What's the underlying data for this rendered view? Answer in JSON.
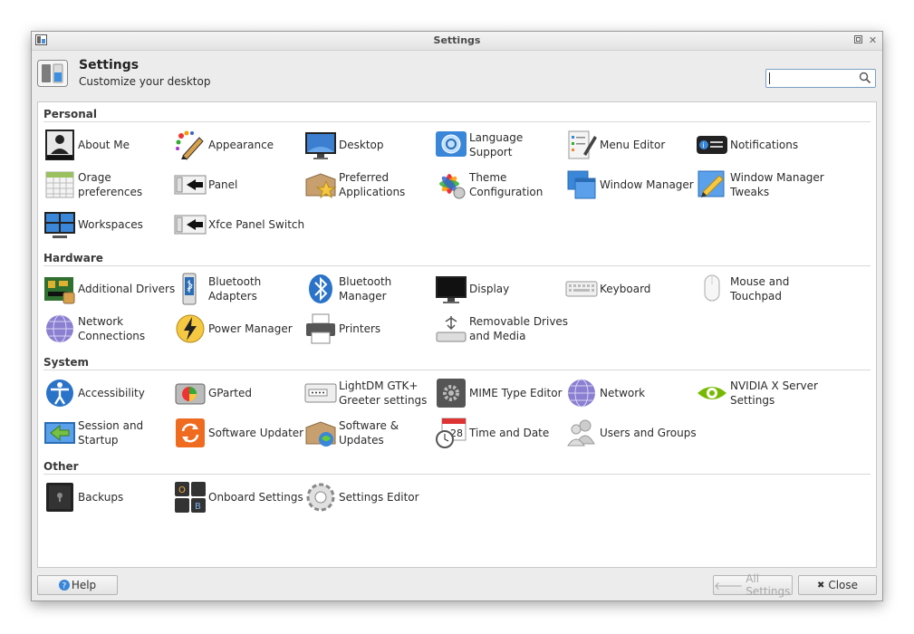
{
  "window": {
    "title": "Settings"
  },
  "header": {
    "title": "Settings",
    "subtitle": "Customize your desktop",
    "search_value": ""
  },
  "sections": [
    {
      "name": "Personal",
      "items": [
        "About Me",
        "Appearance",
        "Desktop",
        "Language Support",
        "Menu Editor",
        "Notifications",
        "Orage preferences",
        "Panel",
        "Preferred Applications",
        "Theme Configuration",
        "Window Manager",
        "Window Manager Tweaks",
        "Workspaces",
        "Xfce Panel Switch"
      ]
    },
    {
      "name": "Hardware",
      "items": [
        "Additional Drivers",
        "Bluetooth Adapters",
        "Bluetooth Manager",
        "Display",
        "Keyboard",
        "Mouse and Touchpad",
        "Network Connections",
        "Power Manager",
        "Printers",
        "Removable Drives and Media"
      ]
    },
    {
      "name": "System",
      "items": [
        "Accessibility",
        "GParted",
        "LightDM GTK+ Greeter settings",
        "MIME Type Editor",
        "Network",
        "NVIDIA X Server Settings",
        "Session and Startup",
        "Software Updater",
        "Software & Updates",
        "Time and Date",
        "Users and Groups"
      ]
    },
    {
      "name": "Other",
      "items": [
        "Backups",
        "Onboard Settings",
        "Settings Editor"
      ]
    }
  ],
  "footer": {
    "help": "Help",
    "all_settings": "All Settings",
    "close": "Close"
  }
}
